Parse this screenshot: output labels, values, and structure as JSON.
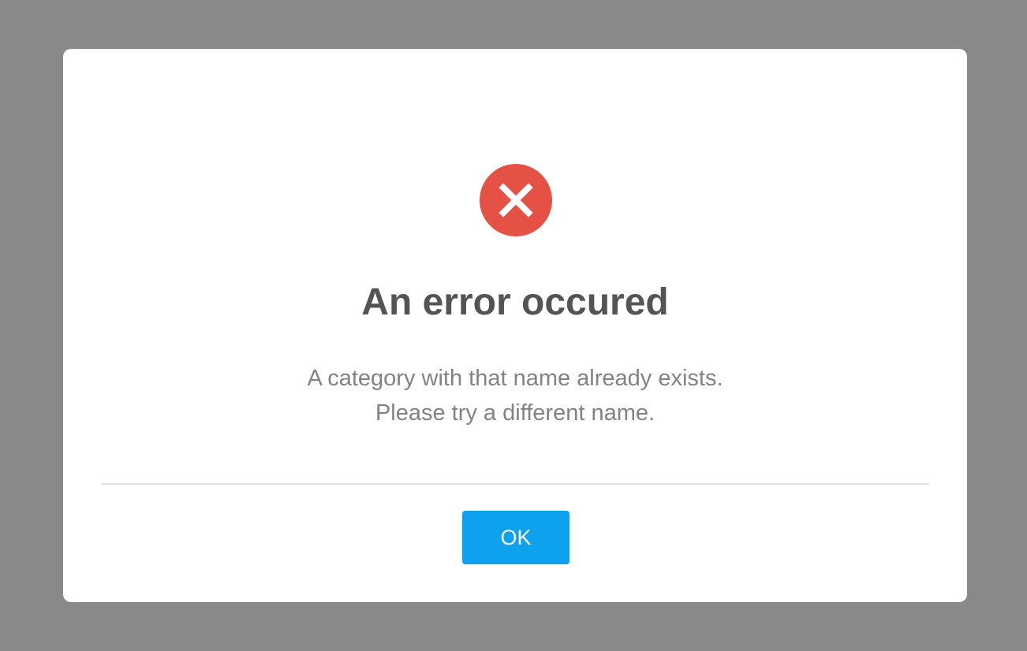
{
  "dialog": {
    "icon": "error-x-icon",
    "title": "An error occured",
    "message_lines": [
      "A category with that name already exists.",
      "Please try a different name."
    ],
    "ok_label": "OK"
  },
  "colors": {
    "backdrop": "#898989",
    "error": "#e55245",
    "button": "#0ea1ed",
    "title_text": "#545454",
    "message_text": "#828282"
  }
}
